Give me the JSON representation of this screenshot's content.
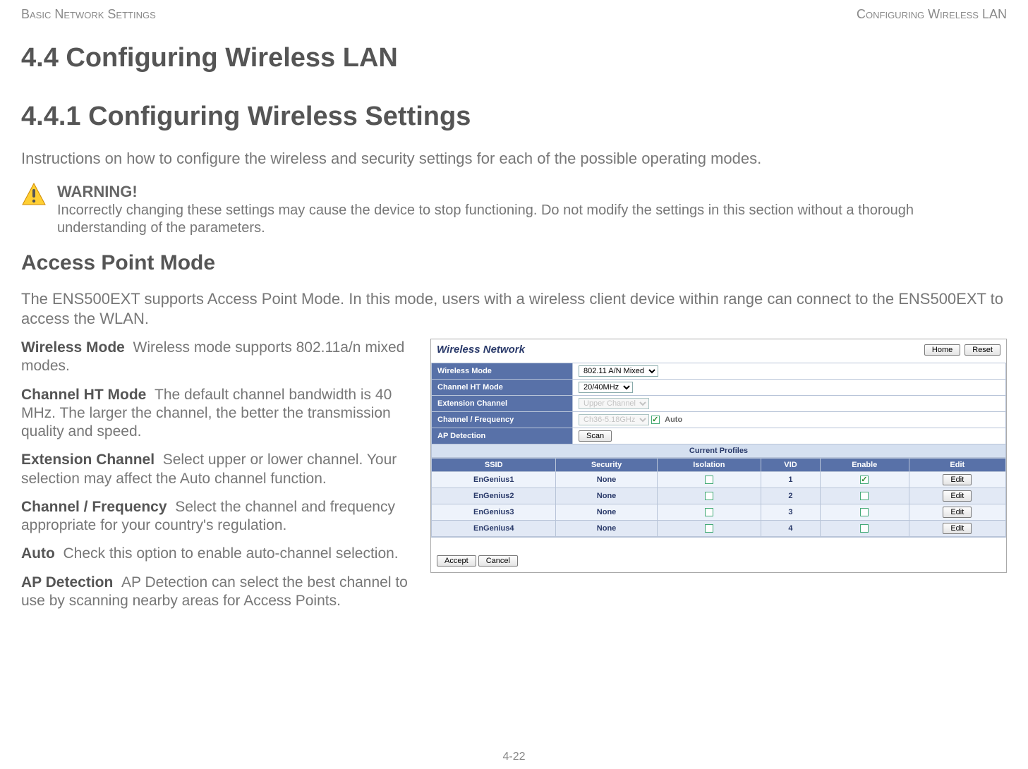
{
  "header": {
    "left": "Basic Network Settings",
    "right": "Configuring Wireless LAN"
  },
  "section": {
    "num_title": "4.4 Configuring Wireless LAN",
    "sub_num_title": "4.4.1 Configuring Wireless Settings"
  },
  "intro": "Instructions on how to configure the wireless and security settings for each of the possible operating modes.",
  "warning": {
    "label": "WARNING!",
    "text": "Incorrectly changing these settings may cause the device to stop functioning. Do not modify the settings in this section without a thorough understanding of the parameters."
  },
  "mode": {
    "title": "Access Point Mode",
    "intro": "The ENS500EXT supports Access Point Mode. In this mode, users with a wireless client device within range can connect to the ENS500EXT to access the WLAN."
  },
  "params": {
    "wireless_mode": {
      "name": "Wireless Mode",
      "desc": "Wireless mode supports 802.11a/n mixed modes."
    },
    "channel_ht": {
      "name": "Channel HT Mode",
      "desc": "The default channel bandwidth is 40 MHz. The larger the channel, the better the transmission quality and speed."
    },
    "ext_channel": {
      "name": "Extension Channel",
      "desc": "Select upper or lower channel. Your selection may affect the Auto channel function."
    },
    "channel_freq": {
      "name": "Channel / Frequency",
      "desc": "Select the channel and frequency appropriate for your country's regulation."
    },
    "auto": {
      "name": "Auto",
      "desc": "Check this option to enable auto-channel selection."
    },
    "ap_detect": {
      "name": "AP Detection",
      "desc": "AP Detection can select the best channel to use by scanning nearby areas for Access Points."
    }
  },
  "panel": {
    "title": "Wireless Network",
    "top_buttons": {
      "home": "Home",
      "reset": "Reset"
    },
    "rows": {
      "wireless_mode": {
        "label": "Wireless Mode",
        "value": "802.11 A/N Mixed"
      },
      "channel_ht": {
        "label": "Channel HT Mode",
        "value": "20/40MHz"
      },
      "ext_channel": {
        "label": "Extension Channel",
        "value": "Upper Channel"
      },
      "channel_freq": {
        "label": "Channel / Frequency",
        "value": "Ch36-5.18GHz",
        "auto_label": "Auto",
        "auto_checked": true
      },
      "ap_detect": {
        "label": "AP Detection",
        "button": "Scan"
      }
    },
    "profiles": {
      "header": "Current Profiles",
      "cols": {
        "ssid": "SSID",
        "security": "Security",
        "isolation": "Isolation",
        "vid": "VID",
        "enable": "Enable",
        "edit": "Edit"
      },
      "rows": [
        {
          "ssid": "EnGenius1",
          "security": "None",
          "isolation": false,
          "vid": "1",
          "enable": true,
          "edit": "Edit"
        },
        {
          "ssid": "EnGenius2",
          "security": "None",
          "isolation": false,
          "vid": "2",
          "enable": false,
          "edit": "Edit"
        },
        {
          "ssid": "EnGenius3",
          "security": "None",
          "isolation": false,
          "vid": "3",
          "enable": false,
          "edit": "Edit"
        },
        {
          "ssid": "EnGenius4",
          "security": "None",
          "isolation": false,
          "vid": "4",
          "enable": false,
          "edit": "Edit"
        }
      ]
    },
    "footer": {
      "accept": "Accept",
      "cancel": "Cancel"
    }
  },
  "page_number": "4-22"
}
